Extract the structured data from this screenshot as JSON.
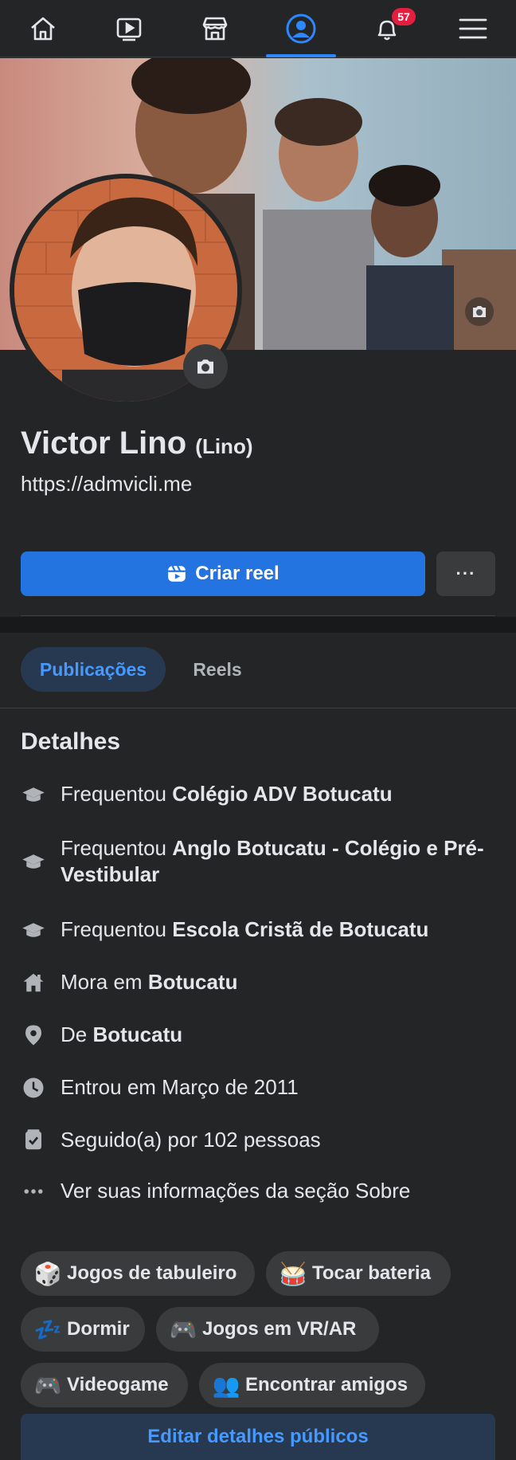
{
  "nav": {
    "items": [
      {
        "name": "home",
        "icon": "home-icon"
      },
      {
        "name": "watch",
        "icon": "video-play-icon"
      },
      {
        "name": "marketplace",
        "icon": "store-icon"
      },
      {
        "name": "profile",
        "icon": "profile-icon",
        "active": true
      },
      {
        "name": "notifications",
        "icon": "bell-icon"
      },
      {
        "name": "menu",
        "icon": "hamburger-menu-icon"
      }
    ],
    "notifications_badge": "57",
    "active_color": "#2d88ff"
  },
  "profile": {
    "name": "Victor Lino",
    "alternate_name": "(Lino)",
    "website": "https://admvicli.me",
    "create_reel_label": "Criar reel",
    "more_label": "···"
  },
  "tabs": [
    {
      "label": "Publicações",
      "active": true
    },
    {
      "label": "Reels",
      "active": false
    }
  ],
  "details": {
    "title": "Detalhes",
    "items": [
      {
        "icon": "graduation-cap-icon",
        "prefix": "Frequentou ",
        "bold": "Colégio ADV Botucatu"
      },
      {
        "icon": "graduation-cap-icon",
        "prefix": "Frequentou ",
        "bold": "Anglo Botucatu - Colégio e Pré-Vestibular"
      },
      {
        "icon": "graduation-cap-icon",
        "prefix": "Frequentou ",
        "bold": "Escola Cristã de Botucatu"
      },
      {
        "icon": "house-icon",
        "prefix": "Mora em ",
        "bold": "Botucatu"
      },
      {
        "icon": "location-pin-icon",
        "prefix": "De ",
        "bold": "Botucatu"
      },
      {
        "icon": "clock-icon",
        "prefix": "Entrou em Março de 2011",
        "bold": ""
      },
      {
        "icon": "followers-icon",
        "prefix": "Seguido(a) por 102 pessoas",
        "bold": ""
      },
      {
        "icon": "more-dots-icon",
        "prefix": "Ver suas informações da seção Sobre",
        "bold": ""
      }
    ]
  },
  "hobbies": [
    {
      "emoji": "🎲",
      "label": "Jogos de tabuleiro"
    },
    {
      "emoji": "🥁",
      "label": "Tocar bateria"
    },
    {
      "emoji": "💤",
      "label": "Dormir"
    },
    {
      "emoji": "🎮",
      "label": "Jogos em VR/AR"
    },
    {
      "emoji": "🎮",
      "label": "Videogame"
    },
    {
      "emoji": "👥",
      "label": "Encontrar amigos"
    }
  ],
  "edit_details_label": "Editar detalhes públicos",
  "colors": {
    "background": "#242526",
    "primary_button": "#2374e1",
    "secondary_button": "#3a3b3c",
    "accent_text": "#4599ff",
    "badge": "#e41e3f"
  }
}
